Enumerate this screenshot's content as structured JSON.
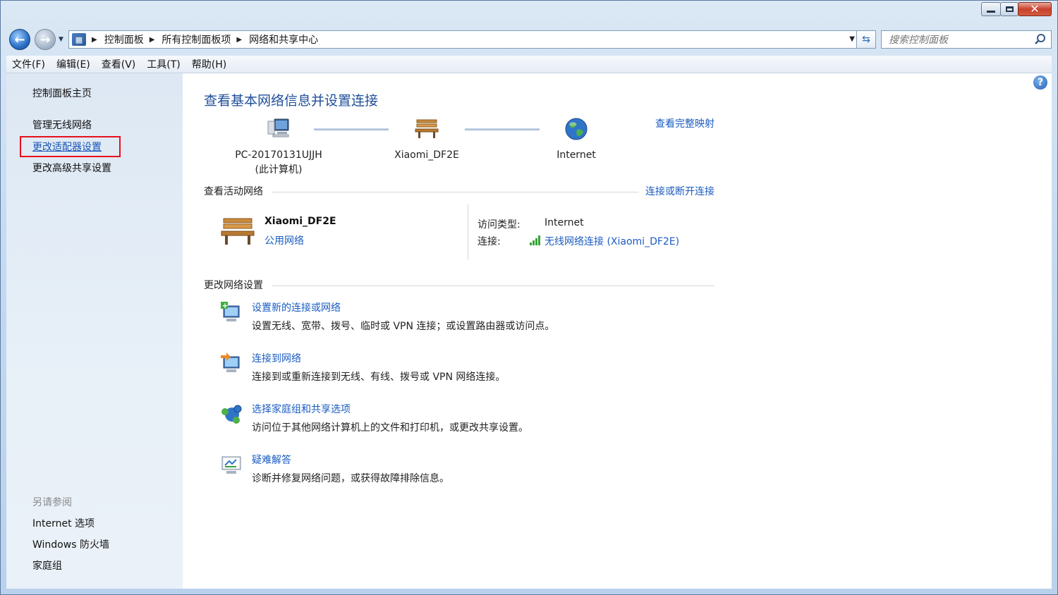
{
  "window": {
    "minimize_icon": "minimize-icon",
    "maximize_icon": "maximize-icon",
    "close_icon": "close-icon"
  },
  "address_bar": {
    "breadcrumbs": [
      "控制面板",
      "所有控制面板项",
      "网络和共享中心"
    ]
  },
  "search": {
    "placeholder": "搜索控制面板"
  },
  "menu": {
    "items": [
      "文件(F)",
      "编辑(E)",
      "查看(V)",
      "工具(T)",
      "帮助(H)"
    ]
  },
  "sidebar": {
    "home": "控制面板主页",
    "links": [
      "管理无线网络",
      "更改适配器设置",
      "更改高级共享设置"
    ],
    "see_also_header": "另请参阅",
    "see_also": [
      "Internet 选项",
      "Windows 防火墙",
      "家庭组"
    ]
  },
  "main": {
    "title": "查看基本网络信息并设置连接",
    "map_link": "查看完整映射",
    "nodes": {
      "computer_name": "PC-20170131UJJH",
      "computer_sub": "(此计算机)",
      "router": "Xiaomi_DF2E",
      "internet": "Internet"
    },
    "active_header": "查看活动网络",
    "connect_link": "连接或断开连接",
    "active_network": {
      "name": "Xiaomi_DF2E",
      "type": "公用网络",
      "access_label": "访问类型:",
      "access_value": "Internet",
      "connection_label": "连接:",
      "connection_value": "无线网络连接 (Xiaomi_DF2E)"
    },
    "change_header": "更改网络设置",
    "tasks": [
      {
        "title": "设置新的连接或网络",
        "desc": "设置无线、宽带、拨号、临时或 VPN 连接；或设置路由器或访问点。"
      },
      {
        "title": "连接到网络",
        "desc": "连接到或重新连接到无线、有线、拨号或 VPN 网络连接。"
      },
      {
        "title": "选择家庭组和共享选项",
        "desc": "访问位于其他网络计算机上的文件和打印机，或更改共享设置。"
      },
      {
        "title": "疑难解答",
        "desc": "诊断并修复网络问题，或获得故障排除信息。"
      }
    ]
  },
  "colors": {
    "link": "#1b5cc2",
    "title": "#1f4f9a",
    "highlight": "#e8101c"
  }
}
